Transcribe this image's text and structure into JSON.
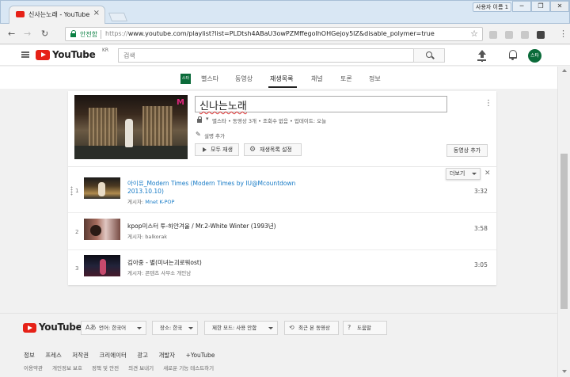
{
  "browser": {
    "tab_title": "신사는노래 - YouTube",
    "tab_close": "×",
    "user_chip": "사용자 이름 1",
    "window_controls": [
      "─",
      "❐",
      "✕"
    ],
    "secure_label": "안전함",
    "url_scheme": "https://",
    "url_rest": "www.youtube.com/playlist?list=PLDtsh4ABaU3owPZMffegolhOHGejoy5lZ&disable_polymer=true",
    "nav_back": "←",
    "nav_forward": "→",
    "nav_reload": "↻",
    "star": "☆",
    "menu": "⋮"
  },
  "masthead": {
    "logo_word": "YouTube",
    "region": "KR",
    "search_placeholder": "검색",
    "avatar_label": "스타"
  },
  "channel": {
    "avatar_label": "스타",
    "tabs": [
      "별스타",
      "동영상",
      "재생목록",
      "채널",
      "토론",
      "정보"
    ],
    "active_tab": "재생목록"
  },
  "playlist": {
    "title": "신나는노래",
    "meta": "별스타 • 동영상 3개 • 조회수 없음 • 업데이트: 오늘",
    "add_description": "설명 추가",
    "play_all": "모두 재생",
    "playlist_settings": "재생목록 설정",
    "add_video": "동영상 추가",
    "more": "더보기",
    "remove": "✕",
    "kebab": "⋮",
    "poster_prefix": "게시자:",
    "videos": [
      {
        "index": "1",
        "title_line1": "아이유_Modern Times (Modern Times by IU@Mcountdown",
        "title_line2": "2013.10.10)",
        "channel": "Mnet K-POP",
        "duration": "3:32"
      },
      {
        "index": "2",
        "title_line1": "kpop미스터 투-하얀겨울 / Mr.2-White Winter (1993년)",
        "title_line2": "",
        "channel": "balkorak",
        "duration": "3:58"
      },
      {
        "index": "3",
        "title_line1": "김아중 - 별(미녀는괴로워ost)",
        "title_line2": "",
        "channel": "콘텐츠 사무소 개인남",
        "duration": "3:05"
      }
    ]
  },
  "footer": {
    "logo_word": "YouTube",
    "buttons": [
      {
        "icon": "Aあ",
        "label": "언어: 한국어"
      },
      {
        "icon": "",
        "label": "장소: 한국"
      },
      {
        "icon": "",
        "label": "제한 모드: 사용 안함"
      },
      {
        "icon": "⟲",
        "label": "최근 본 동영상"
      },
      {
        "icon": "?",
        "label": "도움말"
      }
    ],
    "links1": [
      "정보",
      "프레스",
      "저작권",
      "크리에이터",
      "광고",
      "개발자",
      "+YouTube"
    ],
    "links2": [
      "이용약관",
      "개인정보 보호",
      "정책 및 안전",
      "의견 보내기",
      "새로운 기능 테스트하기"
    ]
  },
  "colors": {
    "brand_red": "#e62117",
    "link_blue": "#167ac6",
    "secure_green": "#0b8043",
    "avatar_green": "#0b6b3a"
  }
}
